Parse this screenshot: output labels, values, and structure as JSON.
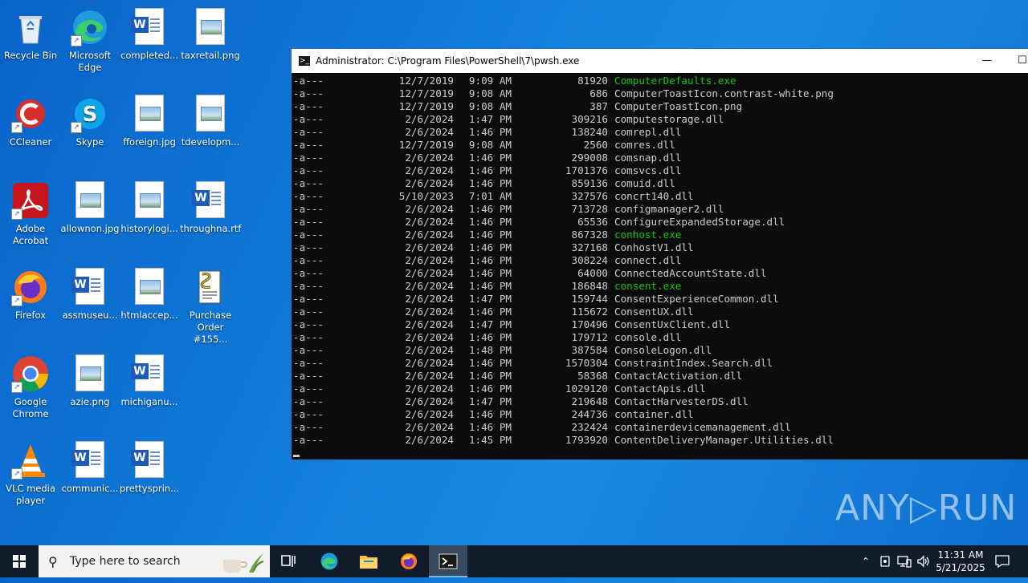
{
  "desktop": {
    "icons": [
      {
        "label": "Recycle Bin"
      },
      {
        "label": "Microsoft Edge"
      },
      {
        "label": "completed..."
      },
      {
        "label": "taxretail.png"
      },
      {
        "label": "CCleaner"
      },
      {
        "label": "Skype"
      },
      {
        "label": "fforeign.jpg"
      },
      {
        "label": "tdevelopm..."
      },
      {
        "label": "Adobe Acrobat"
      },
      {
        "label": "allownon.jpg"
      },
      {
        "label": "historylogi..."
      },
      {
        "label": "throughna.rtf"
      },
      {
        "label": "Firefox"
      },
      {
        "label": "assmuseu..."
      },
      {
        "label": "htmlaccep..."
      },
      {
        "label": "Purchase Order #155..."
      },
      {
        "label": "Google Chrome"
      },
      {
        "label": "azie.png"
      },
      {
        "label": "michiganu..."
      },
      {
        "label": "VLC media player"
      },
      {
        "label": "communic..."
      },
      {
        "label": "prettysprin..."
      }
    ]
  },
  "window": {
    "title": "Administrator: C:\\Program Files\\PowerShell\\7\\pwsh.exe",
    "minimize_glyph": "—",
    "maximize_glyph": "☐",
    "rows": [
      {
        "mode": "-a---",
        "date": "12/7/2019",
        "time": "9:09 AM",
        "length": "81920",
        "name": "ComputerDefaults.exe",
        "exe": true
      },
      {
        "mode": "-a---",
        "date": "12/7/2019",
        "time": "9:08 AM",
        "length": "686",
        "name": "ComputerToastIcon.contrast-white.png",
        "exe": false
      },
      {
        "mode": "-a---",
        "date": "12/7/2019",
        "time": "9:08 AM",
        "length": "387",
        "name": "ComputerToastIcon.png",
        "exe": false
      },
      {
        "mode": "-a---",
        "date": "2/6/2024",
        "time": "1:47 PM",
        "length": "309216",
        "name": "computestorage.dll",
        "exe": false
      },
      {
        "mode": "-a---",
        "date": "2/6/2024",
        "time": "1:46 PM",
        "length": "138240",
        "name": "comrepl.dll",
        "exe": false
      },
      {
        "mode": "-a---",
        "date": "12/7/2019",
        "time": "9:08 AM",
        "length": "2560",
        "name": "comres.dll",
        "exe": false
      },
      {
        "mode": "-a---",
        "date": "2/6/2024",
        "time": "1:46 PM",
        "length": "299008",
        "name": "comsnap.dll",
        "exe": false
      },
      {
        "mode": "-a---",
        "date": "2/6/2024",
        "time": "1:46 PM",
        "length": "1701376",
        "name": "comsvcs.dll",
        "exe": false
      },
      {
        "mode": "-a---",
        "date": "2/6/2024",
        "time": "1:46 PM",
        "length": "859136",
        "name": "comuid.dll",
        "exe": false
      },
      {
        "mode": "-a---",
        "date": "5/10/2023",
        "time": "7:01 AM",
        "length": "327576",
        "name": "concrt140.dll",
        "exe": false
      },
      {
        "mode": "-a---",
        "date": "2/6/2024",
        "time": "1:46 PM",
        "length": "713728",
        "name": "configmanager2.dll",
        "exe": false
      },
      {
        "mode": "-a---",
        "date": "2/6/2024",
        "time": "1:46 PM",
        "length": "65536",
        "name": "ConfigureExpandedStorage.dll",
        "exe": false
      },
      {
        "mode": "-a---",
        "date": "2/6/2024",
        "time": "1:46 PM",
        "length": "867328",
        "name": "conhost.exe",
        "exe": true
      },
      {
        "mode": "-a---",
        "date": "2/6/2024",
        "time": "1:46 PM",
        "length": "327168",
        "name": "ConhostV1.dll",
        "exe": false
      },
      {
        "mode": "-a---",
        "date": "2/6/2024",
        "time": "1:46 PM",
        "length": "308224",
        "name": "connect.dll",
        "exe": false
      },
      {
        "mode": "-a---",
        "date": "2/6/2024",
        "time": "1:46 PM",
        "length": "64000",
        "name": "ConnectedAccountState.dll",
        "exe": false
      },
      {
        "mode": "-a---",
        "date": "2/6/2024",
        "time": "1:46 PM",
        "length": "186848",
        "name": "consent.exe",
        "exe": true
      },
      {
        "mode": "-a---",
        "date": "2/6/2024",
        "time": "1:47 PM",
        "length": "159744",
        "name": "ConsentExperienceCommon.dll",
        "exe": false
      },
      {
        "mode": "-a---",
        "date": "2/6/2024",
        "time": "1:46 PM",
        "length": "115672",
        "name": "ConsentUX.dll",
        "exe": false
      },
      {
        "mode": "-a---",
        "date": "2/6/2024",
        "time": "1:47 PM",
        "length": "170496",
        "name": "ConsentUxClient.dll",
        "exe": false
      },
      {
        "mode": "-a---",
        "date": "2/6/2024",
        "time": "1:46 PM",
        "length": "179712",
        "name": "console.dll",
        "exe": false
      },
      {
        "mode": "-a---",
        "date": "2/6/2024",
        "time": "1:48 PM",
        "length": "387584",
        "name": "ConsoleLogon.dll",
        "exe": false
      },
      {
        "mode": "-a---",
        "date": "2/6/2024",
        "time": "1:46 PM",
        "length": "1570304",
        "name": "ConstraintIndex.Search.dll",
        "exe": false
      },
      {
        "mode": "-a---",
        "date": "2/6/2024",
        "time": "1:46 PM",
        "length": "58368",
        "name": "ContactActivation.dll",
        "exe": false
      },
      {
        "mode": "-a---",
        "date": "2/6/2024",
        "time": "1:46 PM",
        "length": "1029120",
        "name": "ContactApis.dll",
        "exe": false
      },
      {
        "mode": "-a---",
        "date": "2/6/2024",
        "time": "1:47 PM",
        "length": "219648",
        "name": "ContactHarvesterDS.dll",
        "exe": false
      },
      {
        "mode": "-a---",
        "date": "2/6/2024",
        "time": "1:46 PM",
        "length": "244736",
        "name": "container.dll",
        "exe": false
      },
      {
        "mode": "-a---",
        "date": "2/6/2024",
        "time": "1:46 PM",
        "length": "232424",
        "name": "containerdevicemanagement.dll",
        "exe": false
      },
      {
        "mode": "-a---",
        "date": "2/6/2024",
        "time": "1:45 PM",
        "length": "1793920",
        "name": "ContentDeliveryManager.Utilities.dll",
        "exe": false
      }
    ]
  },
  "taskbar": {
    "search_placeholder": "Type here to search",
    "time": "11:31 AM",
    "date": "5/21/2025"
  },
  "watermark": {
    "text": "ANY▷RUN"
  },
  "colors": {
    "exe_green": "#16c60c",
    "console_fg": "#cccccc",
    "console_bg": "#0c0c0c"
  }
}
